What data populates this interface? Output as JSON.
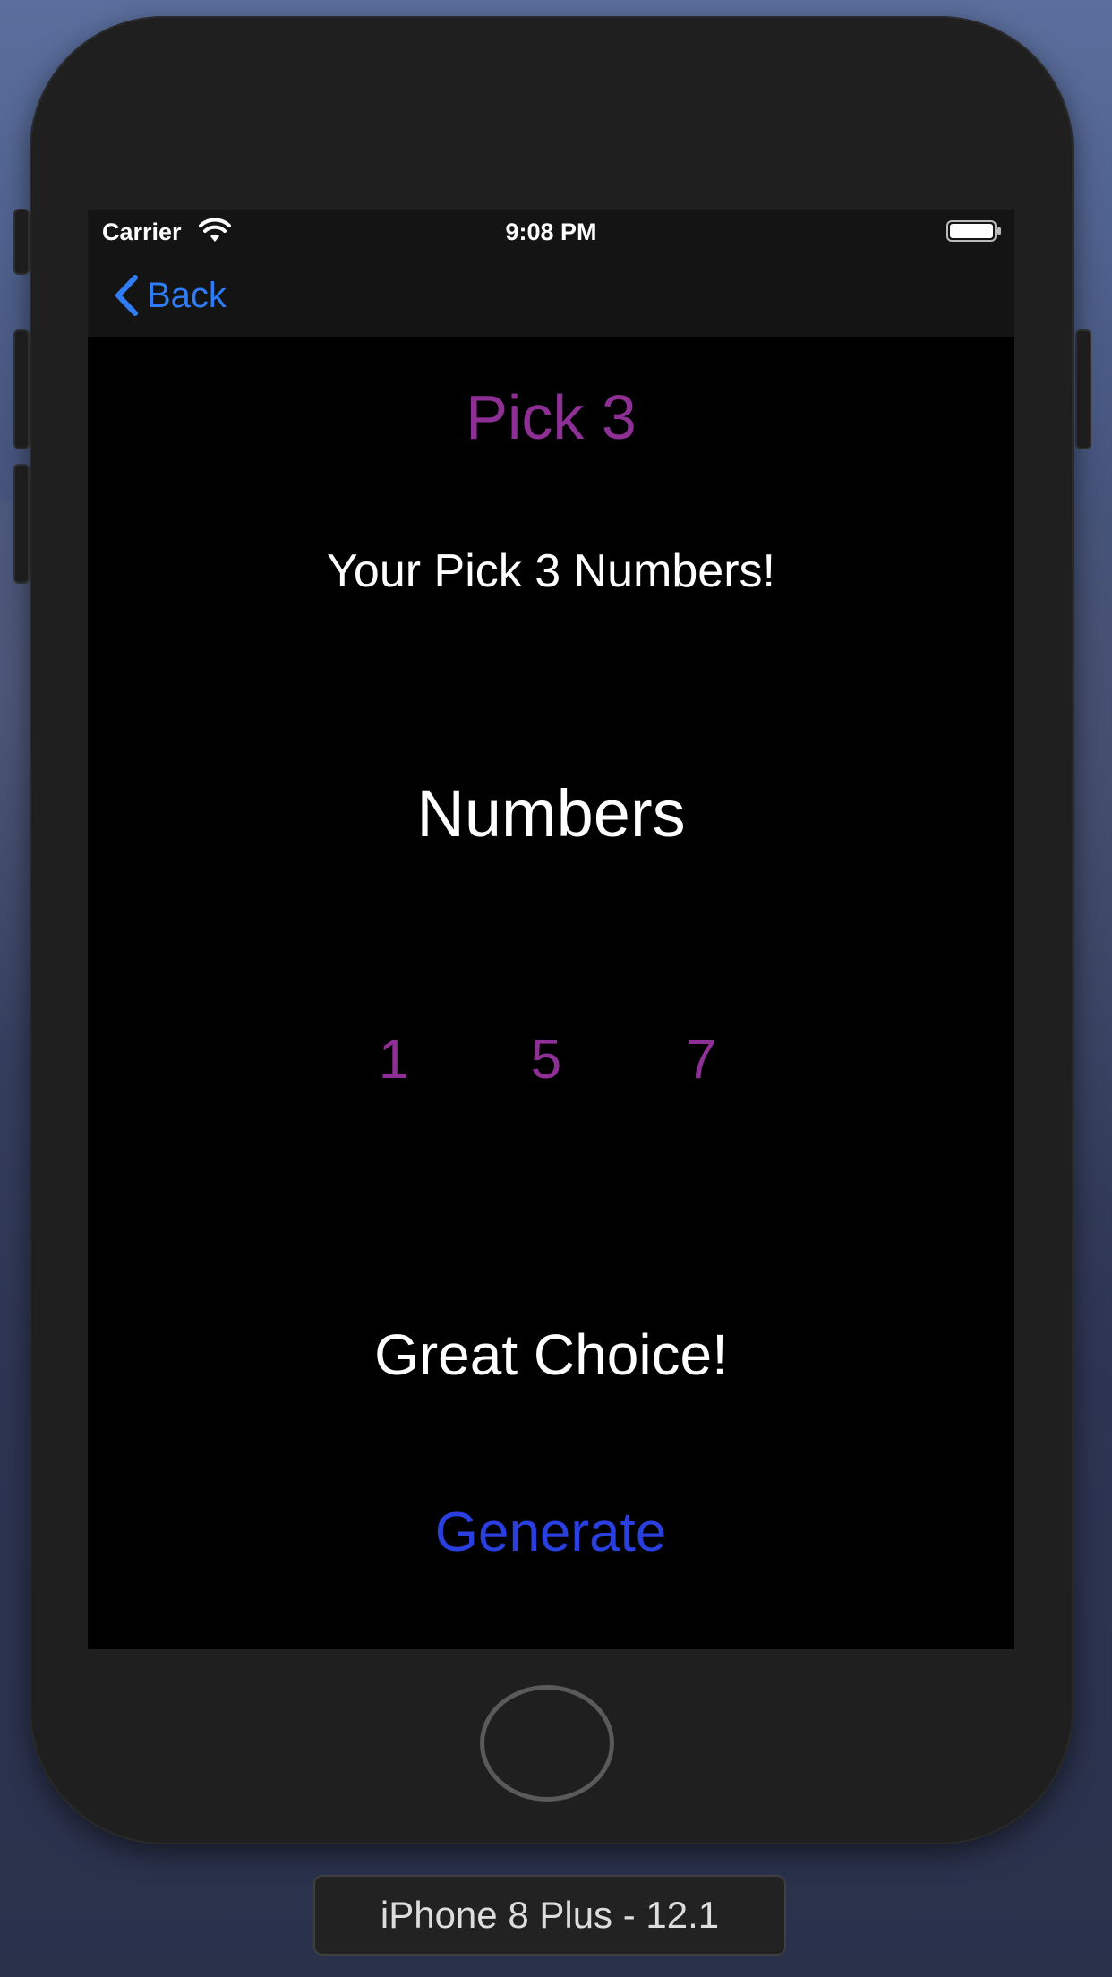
{
  "status_bar": {
    "carrier": "Carrier",
    "time": "9:08 PM"
  },
  "nav": {
    "back_label": "Back"
  },
  "main": {
    "title": "Pick 3",
    "subtitle": "Your Pick 3 Numbers!",
    "numbers_heading": "Numbers",
    "numbers": [
      "1",
      "5",
      "7"
    ],
    "message": "Great Choice!",
    "generate_label": "Generate"
  },
  "simulator": {
    "device_label": "iPhone 8 Plus - 12.1"
  },
  "colors": {
    "accent_purple": "#8e2f95",
    "link_blue": "#2f7cf6",
    "button_blue": "#2a3fe0",
    "screen_background": "#000000"
  },
  "icons": [
    "wifi-icon",
    "battery-icon",
    "chevron-left-icon"
  ]
}
